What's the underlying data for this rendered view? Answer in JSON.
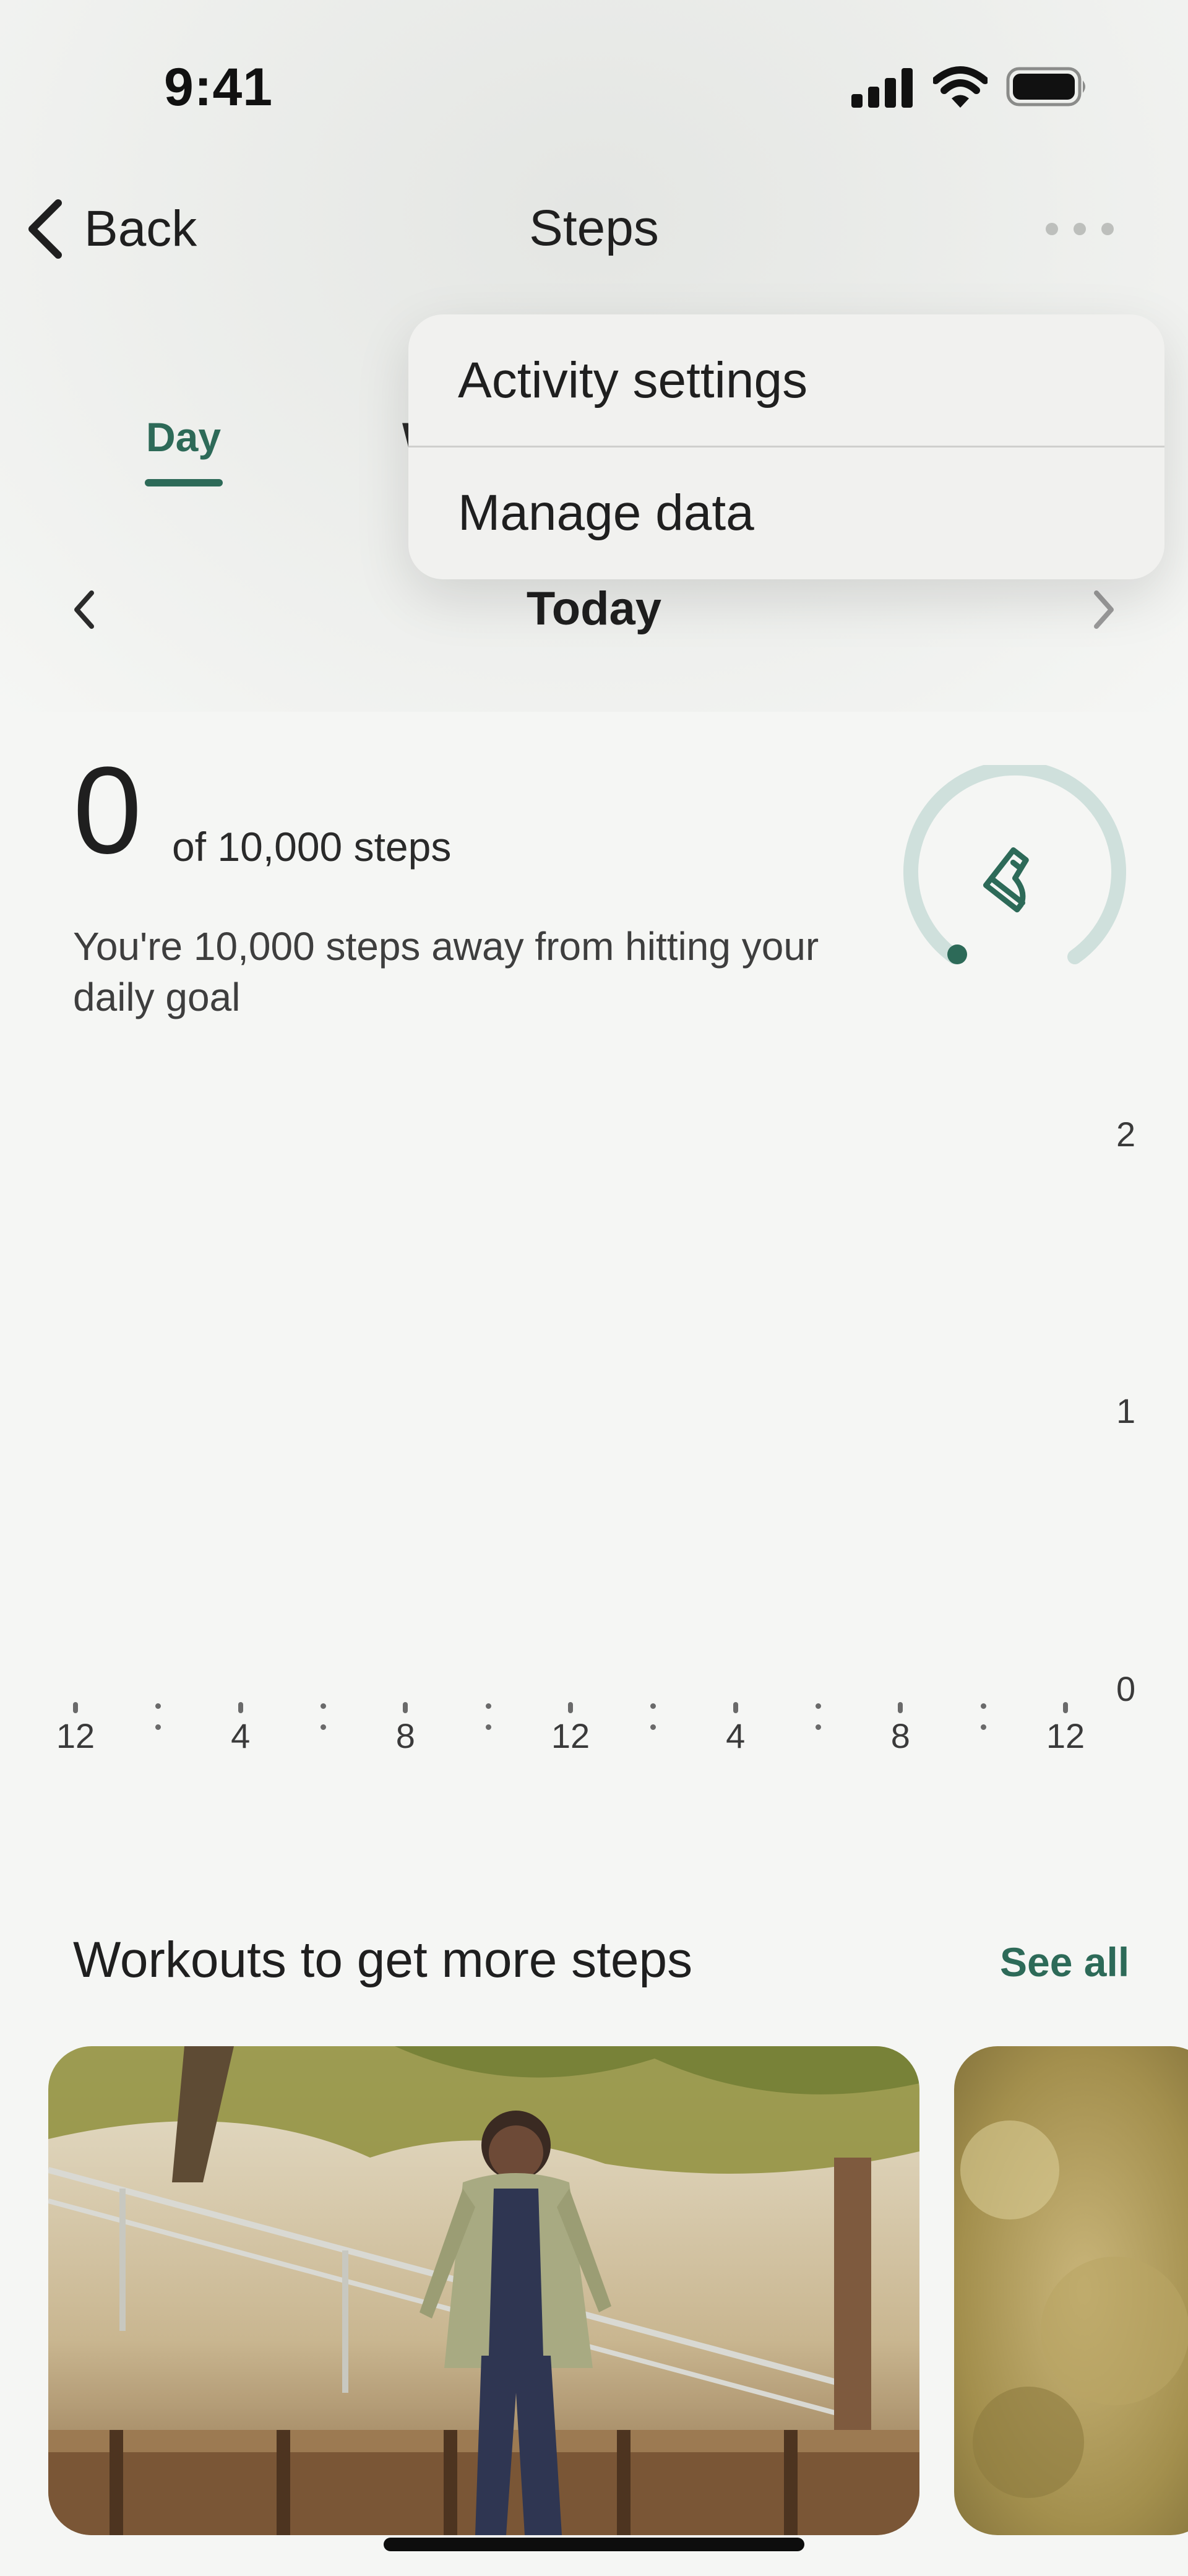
{
  "status_bar": {
    "time": "9:41"
  },
  "header": {
    "back_label": "Back",
    "title": "Steps"
  },
  "tabs": [
    {
      "label": "Day",
      "selected": true
    },
    {
      "label": "W",
      "selected": false
    }
  ],
  "menu": {
    "items": [
      {
        "label": "Activity settings"
      },
      {
        "label": "Manage data"
      }
    ]
  },
  "date_nav": {
    "label": "Today"
  },
  "summary": {
    "count": "0",
    "goal": "of 10,000 steps",
    "message": "You're 10,000 steps away from hitting your daily goal",
    "progress_fraction": 0
  },
  "chart_data": {
    "type": "bar",
    "x_tick_labels": [
      "12",
      "4",
      "8",
      "12",
      "4",
      "8",
      "12"
    ],
    "y_tick_labels": [
      "2",
      "1",
      "0"
    ],
    "ylim": [
      0,
      2
    ],
    "values": []
  },
  "workouts": {
    "title": "Workouts to get more steps",
    "see_all": "See all"
  },
  "colors": {
    "accent": "#2d6a58",
    "ring_track": "#cfe0dc"
  }
}
